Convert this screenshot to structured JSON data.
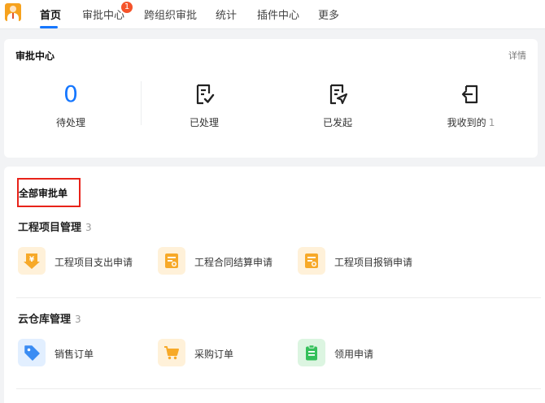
{
  "nav": {
    "tabs": [
      {
        "label": "首页",
        "active": true
      },
      {
        "label": "审批中心",
        "badge": "1"
      },
      {
        "label": "跨组织审批"
      },
      {
        "label": "统计"
      },
      {
        "label": "插件中心"
      },
      {
        "label": "更多"
      }
    ],
    "accent_color": "#1677ff",
    "badge_color": "#f5532a"
  },
  "approval_center": {
    "title": "审批中心",
    "detail_link": "详情",
    "stats": [
      {
        "value": "0",
        "label": "待处理"
      },
      {
        "label": "已处理",
        "icon": "checklist-icon"
      },
      {
        "label": "已发起",
        "icon": "send-document-icon"
      },
      {
        "label": "我收到的",
        "count": "1",
        "icon": "inbox-arrow-icon"
      }
    ]
  },
  "all_approvals": {
    "title": "全部审批单",
    "groups": [
      {
        "name": "工程项目管理",
        "count": "3",
        "items": [
          {
            "label": "工程项目支出申请",
            "icon": "yen-download-icon"
          },
          {
            "label": "工程合同结算申请",
            "icon": "document-stamp-icon"
          },
          {
            "label": "工程项目报销申请",
            "icon": "document-stamp-icon"
          }
        ]
      },
      {
        "name": "云仓库管理",
        "count": "3",
        "items": [
          {
            "label": "销售订单",
            "icon": "price-tag-icon"
          },
          {
            "label": "采购订单",
            "icon": "shopping-cart-icon"
          },
          {
            "label": "领用申请",
            "icon": "clipboard-icon"
          }
        ]
      }
    ]
  },
  "colors": {
    "orange_tile_bg": "#fff1d9",
    "orange_icon": "#f7a928",
    "blue_tile_bg": "#e2efff",
    "blue_icon": "#3a8cf3",
    "green_tile_bg": "#dcf5e1",
    "green_icon": "#34c05a",
    "highlight_red": "#e8231a"
  }
}
